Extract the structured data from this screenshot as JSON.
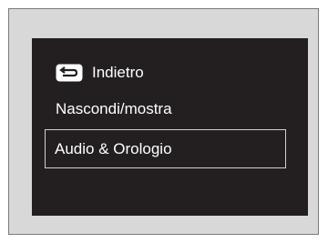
{
  "menu": {
    "items": [
      {
        "label": "Indietro",
        "icon": "back-arrow-icon"
      },
      {
        "label": "Nascondi/mostra"
      },
      {
        "label": "Audio & Orologio",
        "selected": true
      }
    ]
  },
  "colors": {
    "frame_background": "#d8d8d8",
    "screen_background": "#231f20",
    "text": "#ffffff",
    "selection_border": "#d0d0d0"
  }
}
